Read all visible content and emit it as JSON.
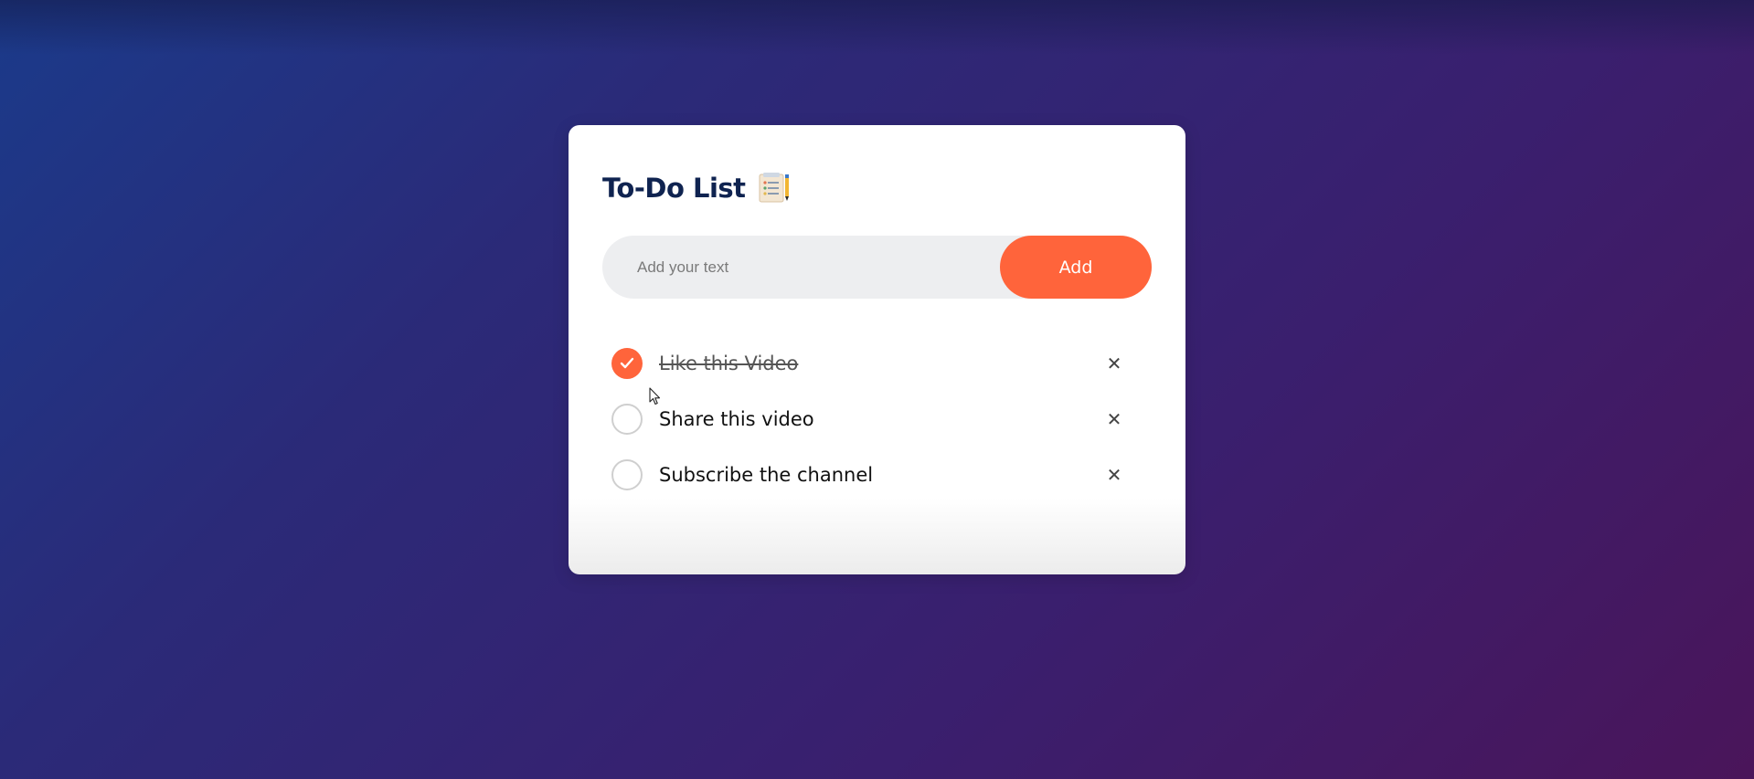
{
  "app": {
    "title": "To-Do List",
    "title_icon": "checklist-pencil-icon"
  },
  "input": {
    "value": "",
    "placeholder": "Add your text"
  },
  "add_button": {
    "label": "Add"
  },
  "todos": [
    {
      "label": "Like this Video",
      "done": true,
      "remove_label": "✕"
    },
    {
      "label": "Share this video",
      "done": false,
      "remove_label": "✕"
    },
    {
      "label": "Subscribe the channel",
      "done": false,
      "remove_label": "✕"
    }
  ],
  "colors": {
    "accent": "#ff643b",
    "title": "#0f2350",
    "input_bg": "#edeef0"
  }
}
